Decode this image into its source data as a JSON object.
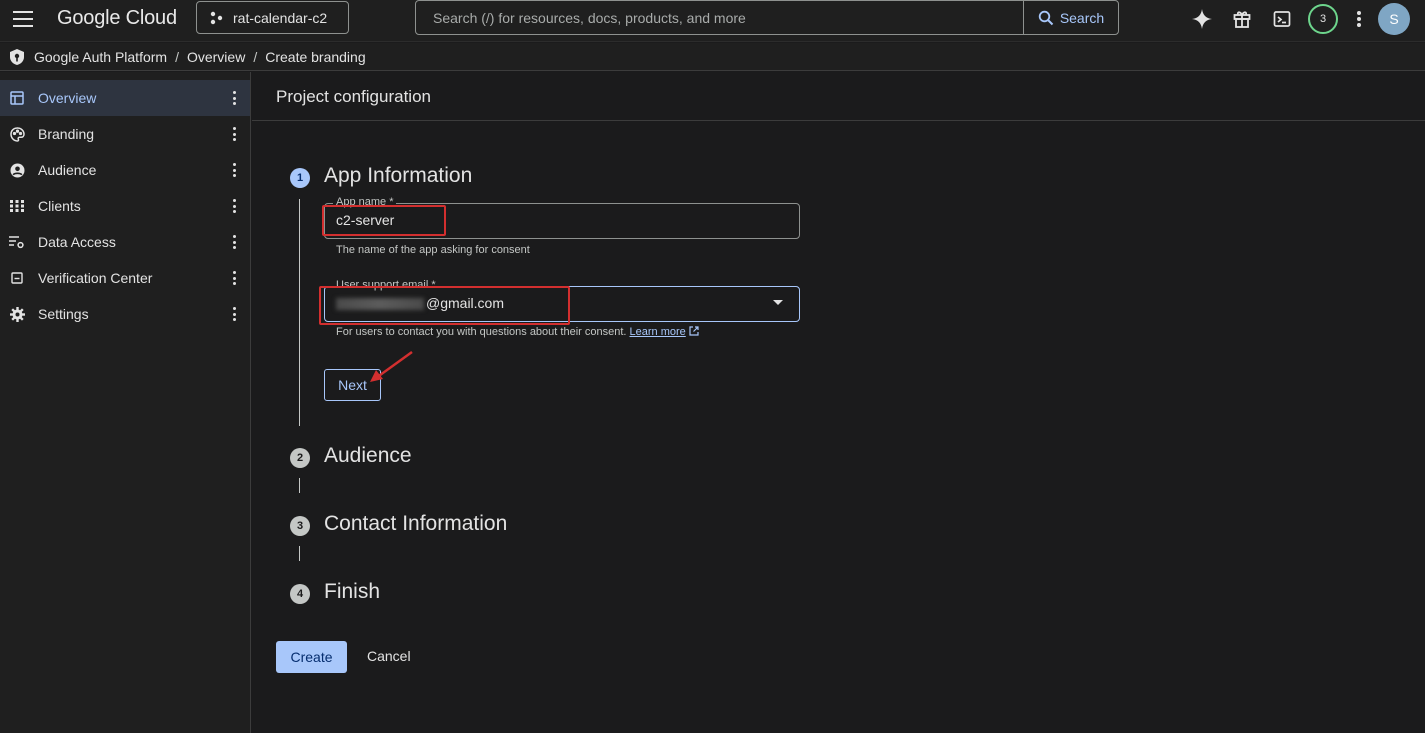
{
  "topbar": {
    "brand": "Google Cloud",
    "project": "rat-calendar-c2",
    "search_placeholder": "Search (/) for resources, docs, products, and more",
    "search_button": "Search",
    "notification_count": "3",
    "avatar_initial": "S"
  },
  "breadcrumb": {
    "items": [
      "Google Auth Platform",
      "Overview",
      "Create branding"
    ],
    "separator": "/"
  },
  "sidebar": {
    "items": [
      {
        "label": "Overview",
        "icon": "dashboard-icon",
        "active": true
      },
      {
        "label": "Branding",
        "icon": "palette-icon"
      },
      {
        "label": "Audience",
        "icon": "account-circle-icon"
      },
      {
        "label": "Clients",
        "icon": "grid-icon"
      },
      {
        "label": "Data Access",
        "icon": "data-settings-icon"
      },
      {
        "label": "Verification Center",
        "icon": "verified-box-icon"
      },
      {
        "label": "Settings",
        "icon": "gear-icon"
      }
    ]
  },
  "main": {
    "header": "Project configuration",
    "steps": [
      {
        "number": "1",
        "title": "App Information"
      },
      {
        "number": "2",
        "title": "Audience"
      },
      {
        "number": "3",
        "title": "Contact Information"
      },
      {
        "number": "4",
        "title": "Finish"
      }
    ],
    "app_name": {
      "label": "App name *",
      "value": "c2-server",
      "hint": "The name of the app asking for consent"
    },
    "support_email": {
      "label": "User support email *",
      "value": "@gmail.com",
      "hint": "For users to contact you with questions about their consent.",
      "learn_more": "Learn more"
    },
    "next_button": "Next",
    "create_button": "Create",
    "cancel_button": "Cancel"
  },
  "colors": {
    "accent": "#a8c7fa",
    "annotation_red": "#d32f2f",
    "notification_ring": "#6dd58c"
  }
}
